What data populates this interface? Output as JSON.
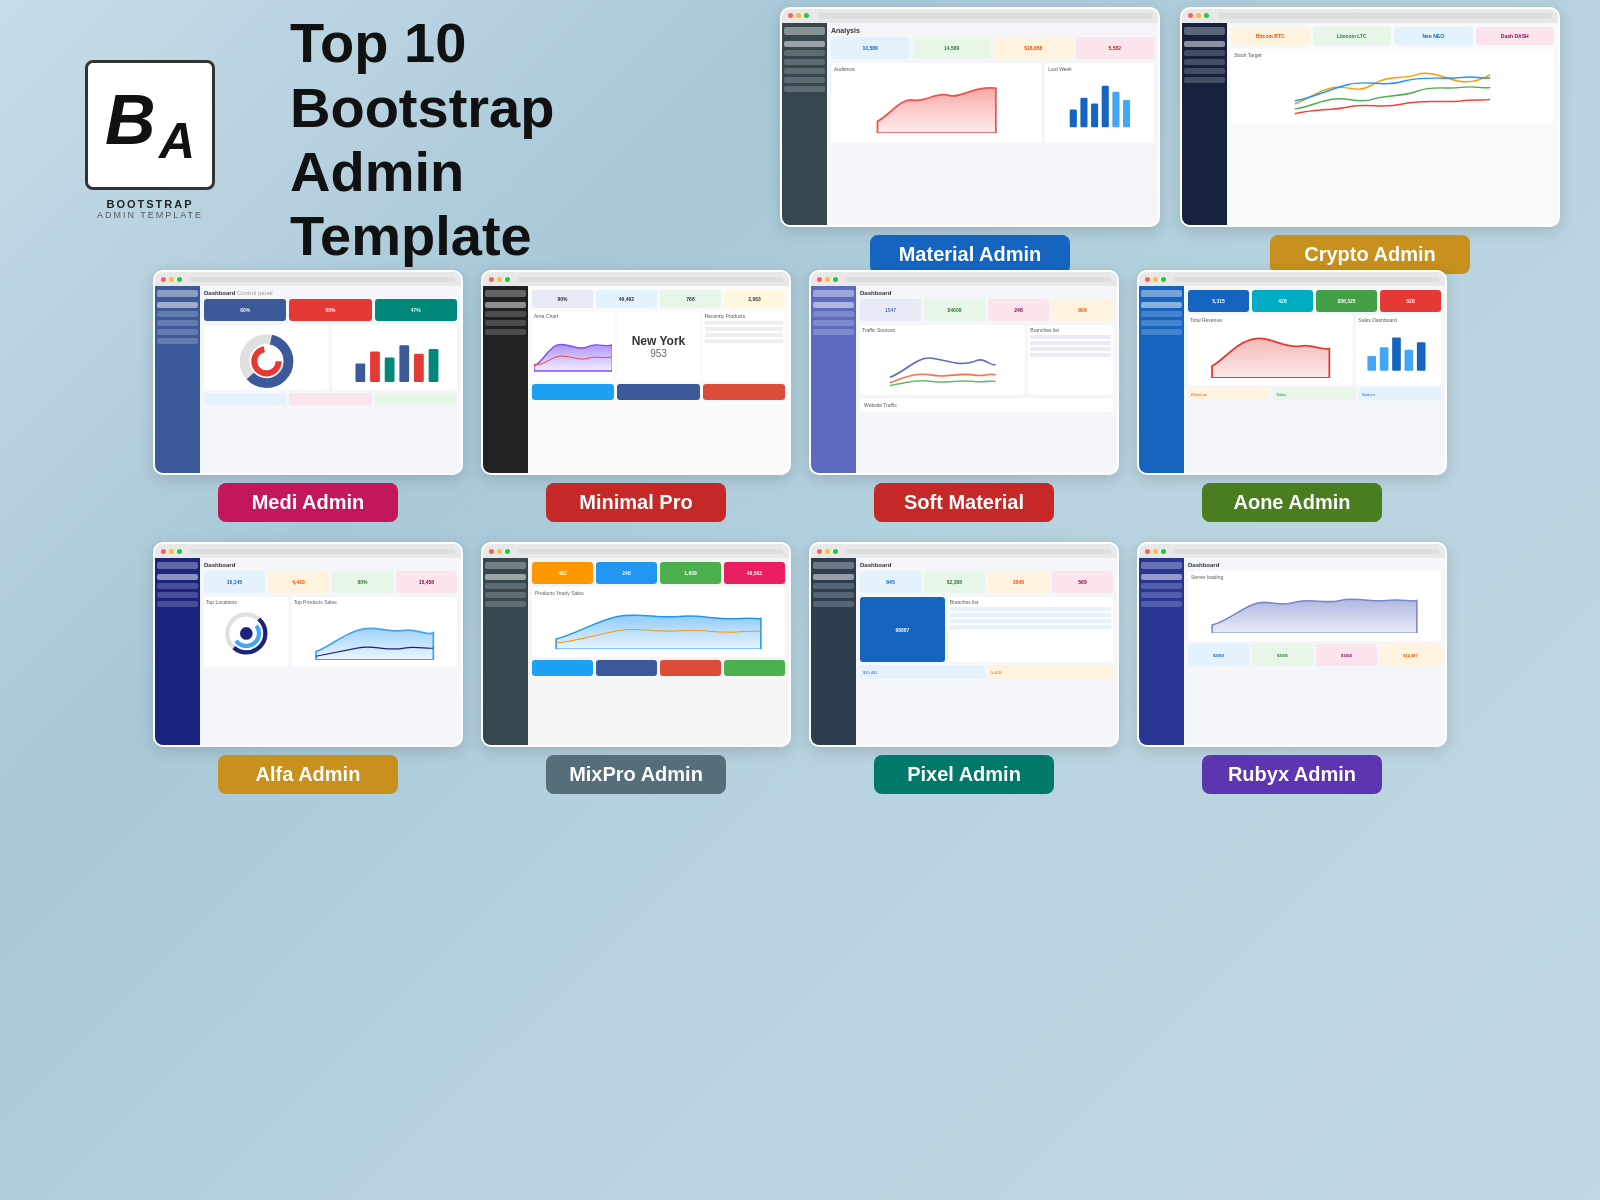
{
  "header": {
    "logo_letters": "BA",
    "logo_top": "BOOTSTRAP",
    "logo_bottom": "ADMIN TEMPLATE",
    "title_line1": "Top 10 Bootstrap",
    "title_line2": "Admin Template"
  },
  "templates": {
    "top_row": [
      {
        "id": "material-admin",
        "name": "Material Admin",
        "label_color": "#1565c0",
        "bg_color": "#1565c0"
      },
      {
        "id": "crypto-admin",
        "name": "Crypto Admin",
        "label_color": "#b8860b",
        "bg_color": "#c8901c"
      }
    ],
    "middle_row": [
      {
        "id": "medi-admin",
        "name": "Medi Admin",
        "label_color": "#c2185b",
        "bg_color": "#c2185b"
      },
      {
        "id": "minimal-pro",
        "name": "Minimal Pro",
        "label_color": "#c2185b",
        "bg_color": "#c62828"
      },
      {
        "id": "soft-material",
        "name": "Soft Material",
        "label_color": "#c62828",
        "bg_color": "#c62828"
      },
      {
        "id": "aone-admin",
        "name": "Aone Admin",
        "label_color": "#33691e",
        "bg_color": "#4a7c20"
      }
    ],
    "bottom_row": [
      {
        "id": "alfa-admin",
        "name": "Alfa Admin",
        "label_color": "#b8860b",
        "bg_color": "#c8901c"
      },
      {
        "id": "mixpro-admin",
        "name": "MixPro Admin",
        "label_color": "#546e7a",
        "bg_color": "#546e7a"
      },
      {
        "id": "pixel-admin",
        "name": "Pixel Admin",
        "label_color": "#00796b",
        "bg_color": "#00796b"
      },
      {
        "id": "rubyx-admin",
        "name": "Rubyx Admin",
        "label_color": "#4527a0",
        "bg_color": "#5e35b1"
      }
    ]
  }
}
